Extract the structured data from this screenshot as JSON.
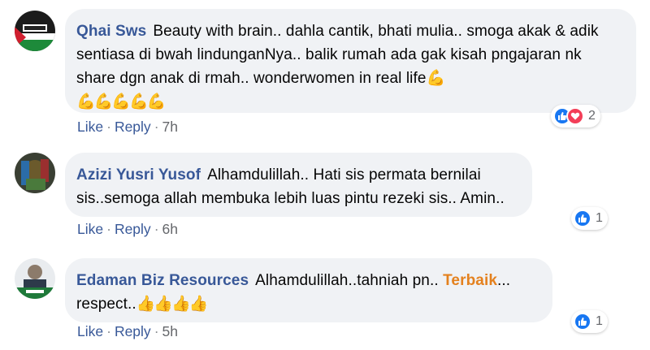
{
  "comments": [
    {
      "author": "Qhai Sws",
      "text": "Beauty with brain.. dahla cantik, bhati mulia.. smoga akak & adik sentiasa di bwah lindunganNya.. balik rumah ada gak kisah pngajaran nk share dgn anak di rmah.. wonderwomen in real life",
      "emoji_line": "💪💪💪💪💪",
      "actions": {
        "like": "Like",
        "reply": "Reply",
        "time": "7h"
      },
      "reaction_icons": [
        "like-icon",
        "love-icon"
      ],
      "reaction_count": "2"
    },
    {
      "author": "Azizi Yusri Yusof",
      "text": "Alhamdulillah.. Hati sis permata bernilai sis..semoga allah membuka lebih luas pintu rezeki sis.. Amin..",
      "actions": {
        "like": "Like",
        "reply": "Reply",
        "time": "6h"
      },
      "reaction_icons": [
        "like-icon"
      ],
      "reaction_count": "1"
    },
    {
      "author": "Edaman Biz Resources",
      "text": "Alhamdulillah..tahniah pn..",
      "mention": "Terbaik",
      "text_after": "... respect..",
      "emoji_line": "👍👍👍👍",
      "actions": {
        "like": "Like",
        "reply": "Reply",
        "time": "5h"
      },
      "reaction_icons": [
        "like-icon"
      ],
      "reaction_count": "1"
    }
  ],
  "colors": {
    "author": "#385898",
    "mention": "#e4811e",
    "bubble": "#f0f2f5",
    "like": "#1877f2",
    "love": "#f33e58"
  }
}
